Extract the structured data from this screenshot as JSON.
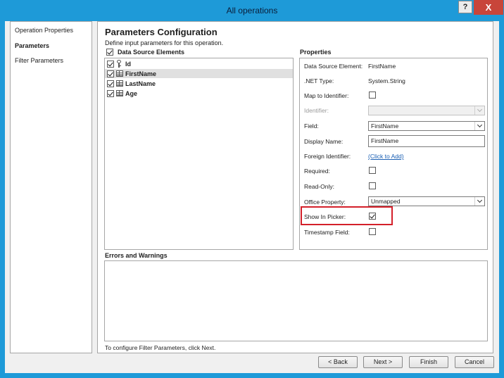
{
  "window": {
    "title": "All operations",
    "help": "?",
    "close": "X"
  },
  "nav": {
    "items": [
      "Operation Properties",
      "Parameters",
      "Filter Parameters"
    ]
  },
  "header": {
    "title": "Parameters Configuration",
    "subtitle": "Define input parameters for this operation."
  },
  "elements": {
    "label": "Data Source Elements",
    "items": [
      {
        "name": "Id",
        "icon": "key-icon",
        "checked": true
      },
      {
        "name": "FirstName",
        "icon": "table-icon",
        "checked": true,
        "selected": true
      },
      {
        "name": "LastName",
        "icon": "table-icon",
        "checked": true
      },
      {
        "name": "Age",
        "icon": "table-icon",
        "checked": true
      }
    ]
  },
  "properties": {
    "label": "Properties",
    "data_source_element": {
      "label": "Data Source Element:",
      "value": "FirstName"
    },
    "net_type": {
      "label": ".NET Type:",
      "value": "System.String"
    },
    "map_to_identifier": {
      "label": "Map to Identifier:"
    },
    "identifier": {
      "label": "Identifier:"
    },
    "field": {
      "label": "Field:",
      "value": "FirstName"
    },
    "display_name": {
      "label": "Display Name:",
      "value": "FirstName"
    },
    "foreign_identifier": {
      "label": "Foreign Identifier:",
      "link": "(Click to Add)"
    },
    "required": {
      "label": "Required:"
    },
    "read_only": {
      "label": "Read-Only:"
    },
    "office_property": {
      "label": "Office Property:",
      "value": "Unmapped"
    },
    "show_in_picker": {
      "label": "Show In Picker:"
    },
    "timestamp_field": {
      "label": "Timestamp Field:"
    }
  },
  "errors": {
    "label": "Errors and Warnings"
  },
  "footer": {
    "hint": "To configure Filter Parameters, click Next."
  },
  "buttons": {
    "back": "< Back",
    "next": "Next >",
    "finish": "Finish",
    "cancel": "Cancel"
  },
  "colors": {
    "titlebar": "#1e9ad8",
    "close": "#c8453a",
    "highlight": "#d4202a",
    "link": "#1a5fb4"
  }
}
